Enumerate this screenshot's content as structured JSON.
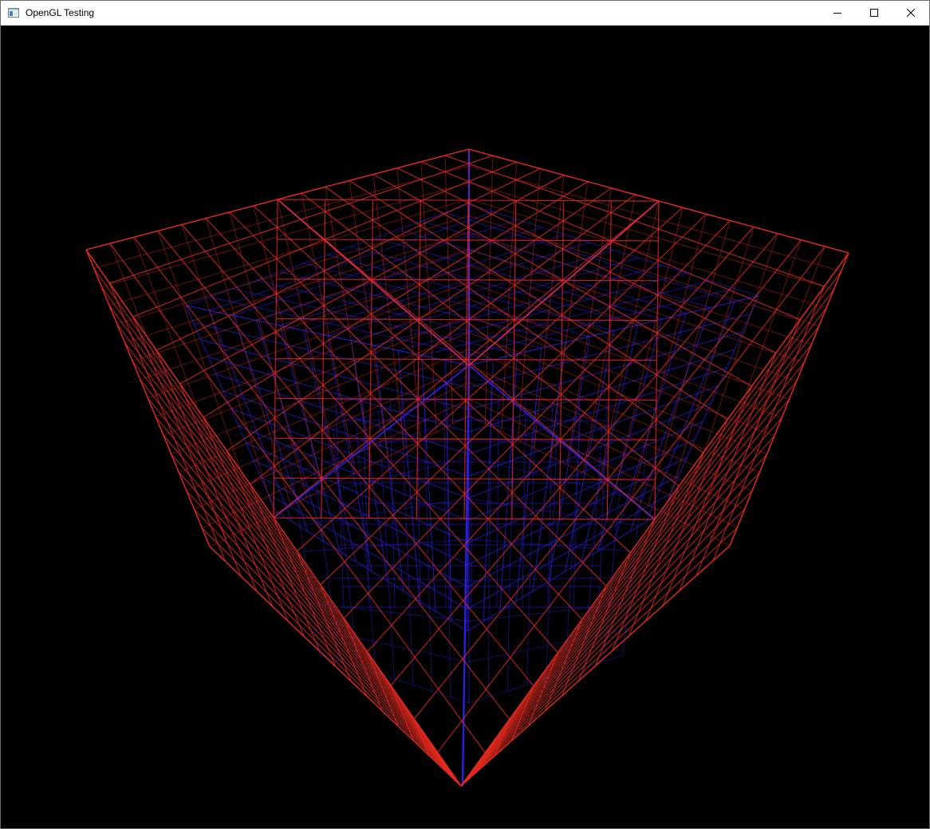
{
  "window": {
    "title": "OpenGL Testing",
    "controls": {
      "minimize": "minimize-icon",
      "maximize": "maximize-icon",
      "close": "close-icon"
    }
  },
  "scene": {
    "background": "#000000",
    "outer_grid_color": "#e62a1e",
    "inner_grid_color": "#2a1fdc",
    "outer_subdivisions": 16,
    "inner_subdivisions": 12
  }
}
